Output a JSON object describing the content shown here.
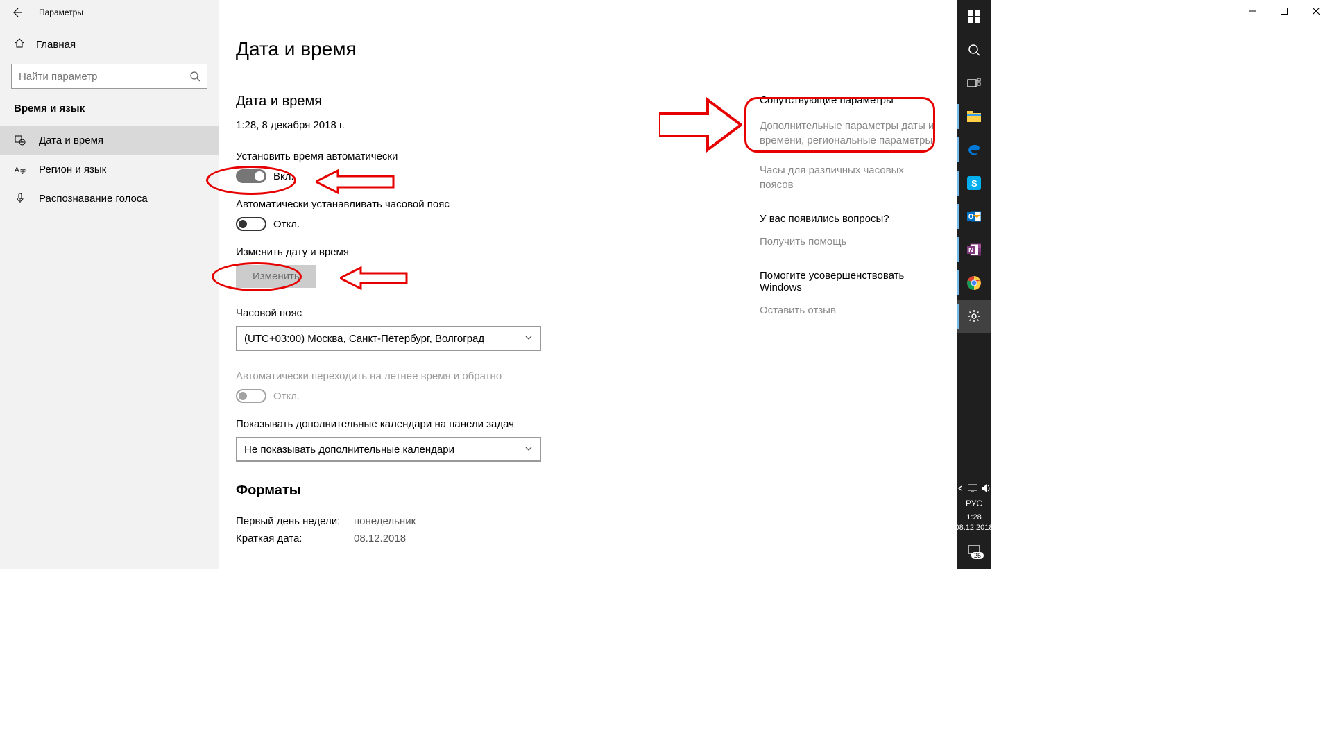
{
  "window": {
    "title": "Параметры"
  },
  "sidebar": {
    "home": "Главная",
    "search_placeholder": "Найти параметр",
    "category": "Время и язык",
    "items": [
      {
        "label": "Дата и время"
      },
      {
        "label": "Регион и язык"
      },
      {
        "label": "Распознавание голоса"
      }
    ]
  },
  "page": {
    "title": "Дата и время",
    "datetime_section": "Дата и время",
    "current_datetime": "1:28, 8 декабря 2018 г.",
    "auto_time_label": "Установить время автоматически",
    "auto_time_state": "Вкл.",
    "auto_tz_label": "Автоматически устанавливать часовой пояс",
    "auto_tz_state": "Откл.",
    "change_label": "Изменить дату и время",
    "change_button": "Изменить",
    "timezone_label": "Часовой пояс",
    "timezone_value": "(UTC+03:00) Москва, Санкт-Петербург, Волгоград",
    "dst_label": "Автоматически переходить на летнее время и обратно",
    "dst_state": "Откл.",
    "calendars_label": "Показывать дополнительные календари на панели задач",
    "calendars_value": "Не показывать дополнительные календари",
    "formats_title": "Форматы",
    "formats": [
      {
        "label": "Первый день недели:",
        "value": "понедельник"
      },
      {
        "label": "Краткая дата:",
        "value": "08.12.2018"
      }
    ]
  },
  "related": {
    "header": "Сопутствующие параметры",
    "link1": "Дополнительные параметры даты и времени, региональные параметры",
    "link2": "Часы для различных часовых поясов",
    "questions_title": "У вас появились вопросы?",
    "help_link": "Получить помощь",
    "feedback_title": "Помогите усовершенствовать Windows",
    "feedback_link": "Оставить отзыв"
  },
  "taskbar": {
    "lang": "РУС",
    "time": "1:28",
    "date": "08.12.2018",
    "notif_count": "25"
  }
}
